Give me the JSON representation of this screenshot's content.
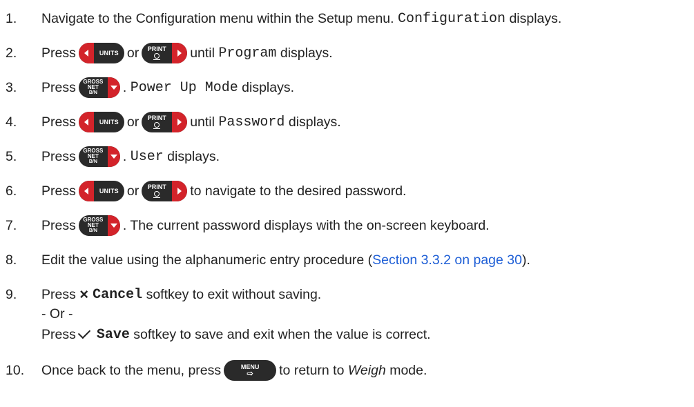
{
  "keys": {
    "units": "UNITS",
    "print": "PRINT",
    "gross_l1": "GROSS",
    "gross_l2": "NET",
    "gross_l3": "B/N",
    "menu": "MENU"
  },
  "steps": [
    {
      "num": "1.",
      "t1": "Navigate to the Configuration menu within the Setup menu.",
      "mono": "Configuration",
      "t2": "displays."
    },
    {
      "num": "2.",
      "t1": "Press",
      "or": "or",
      "t2": "until",
      "mono": "Program",
      "t3": "displays."
    },
    {
      "num": "3.",
      "t1": "Press",
      "mono": "Power Up Mode",
      "t2": "displays."
    },
    {
      "num": "4.",
      "t1": "Press",
      "or": "or",
      "t2": "until",
      "mono": "Password",
      "t3": "displays."
    },
    {
      "num": "5.",
      "t1": "Press",
      "mono": "User",
      "t2": "displays."
    },
    {
      "num": "6.",
      "t1": "Press",
      "or": "or",
      "t2": "to navigate to the desired password."
    },
    {
      "num": "7.",
      "t1": "Press",
      "t2": ". The current password displays with the on-screen keyboard."
    },
    {
      "num": "8.",
      "t1": "Edit the value using the alphanumeric entry procedure (",
      "link": "Section 3.3.2 on page 30",
      "t2": ")."
    },
    {
      "num": "9.",
      "t1": "Press",
      "softkey": "Cancel",
      "t2": "softkey to exit without saving.",
      "or_line": "- Or -",
      "t3": "Press",
      "softkey2": "Save",
      "t4": "softkey to save and exit when the value is correct."
    },
    {
      "num": "10.",
      "t1": "Once back to the menu, press",
      "t2": "to return to",
      "em": "Weigh",
      "t3": "mode."
    }
  ]
}
